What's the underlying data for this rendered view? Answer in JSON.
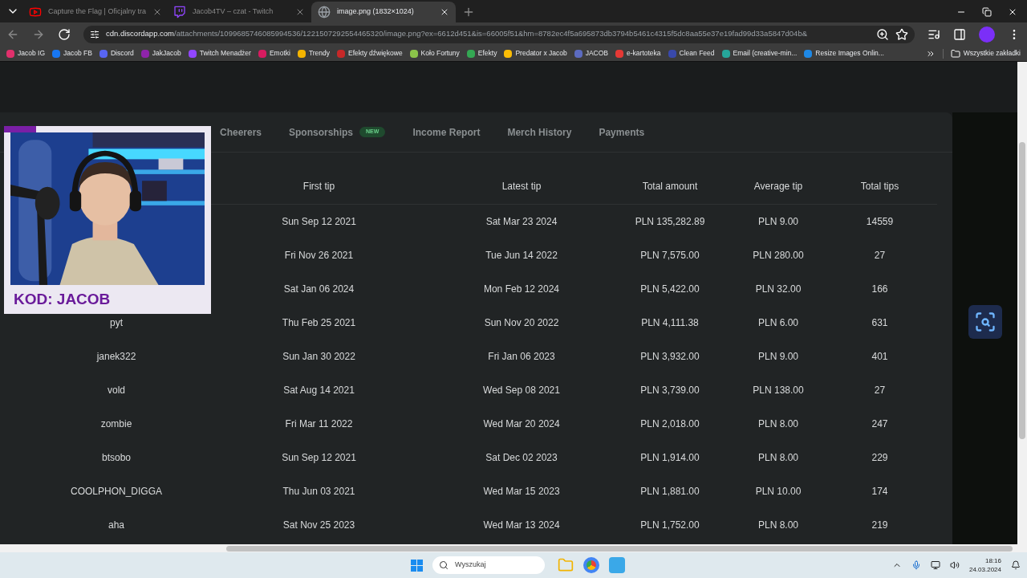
{
  "browser": {
    "tabs": [
      {
        "title": "Capture the Flag | Oficjalny tra",
        "kind": "youtube",
        "selected": false
      },
      {
        "title": "Jacob4TV – czat - Twitch",
        "kind": "twitch",
        "selected": false
      },
      {
        "title": "image.png (1832×1024)",
        "kind": "globe",
        "selected": true
      }
    ],
    "address": {
      "host": "cdn.discordapp.com",
      "path": "/attachments/1099685746085994536/1221507292554465320/image.png?ex=6612d451&is=66005f51&hm=8782ec4f5a695873db3794b5461c4315f5dc8aa55e37e19fad99d33a5847d04b&"
    },
    "bookmarks": [
      {
        "label": "Jacob IG",
        "color": "#e1306c"
      },
      {
        "label": "Jacob FB",
        "color": "#1877f2"
      },
      {
        "label": "Discord",
        "color": "#5865f2"
      },
      {
        "label": "JakJacob",
        "color": "#8e24aa"
      },
      {
        "label": "Twitch Menadżer",
        "color": "#9146ff"
      },
      {
        "label": "Emotki",
        "color": "#d81b60"
      },
      {
        "label": "Trendy",
        "color": "#f4b400"
      },
      {
        "label": "Efekty dźwiękowe",
        "color": "#c62828"
      },
      {
        "label": "Koło Fortuny",
        "color": "#8bc34a"
      },
      {
        "label": "Efekty",
        "color": "#34a853"
      },
      {
        "label": "Predator x Jacob",
        "color": "#fbbc05"
      },
      {
        "label": "JACOB",
        "color": "#5c6bc0"
      },
      {
        "label": "e-kartoteka",
        "color": "#e53935"
      },
      {
        "label": "Clean Feed",
        "color": "#3949ab"
      },
      {
        "label": "Email (creative-min...",
        "color": "#26a69a"
      },
      {
        "label": "Resize Images Onlin...",
        "color": "#1e88e5"
      }
    ],
    "all_bookmarks": "Wszystkie zakładki"
  },
  "page": {
    "tabs": [
      {
        "label": "Cheerers"
      },
      {
        "label": "Sponsorships",
        "badge": "NEW"
      },
      {
        "label": "Income Report"
      },
      {
        "label": "Merch History"
      },
      {
        "label": "Payments"
      }
    ],
    "table": {
      "columns": [
        "First tip",
        "Latest tip",
        "Total amount",
        "Average tip",
        "Total tips"
      ],
      "rows": [
        {
          "first": "Sun Sep 12 2021",
          "latest": "Sat Mar 23 2024",
          "total": "PLN 135,282.89",
          "average": "PLN 9.00",
          "count": "14559"
        },
        {
          "first": "Fri Nov 26 2021",
          "latest": "Tue Jun 14 2022",
          "total": "PLN 7,575.00",
          "average": "PLN 280.00",
          "count": "27"
        },
        {
          "first": "Sat Jan 06 2024",
          "latest": "Mon Feb 12 2024",
          "total": "PLN 5,422.00",
          "average": "PLN 32.00",
          "count": "166"
        },
        {
          "name": "pyt",
          "first": "Thu Feb 25 2021",
          "latest": "Sun Nov 20 2022",
          "total": "PLN 4,111.38",
          "average": "PLN 6.00",
          "count": "631"
        },
        {
          "name": "janek322",
          "first": "Sun Jan 30 2022",
          "latest": "Fri Jan 06 2023",
          "total": "PLN 3,932.00",
          "average": "PLN 9.00",
          "count": "401"
        },
        {
          "name": "vold",
          "first": "Sat Aug 14 2021",
          "latest": "Wed Sep 08 2021",
          "total": "PLN 3,739.00",
          "average": "PLN 138.00",
          "count": "27"
        },
        {
          "name": "zombie",
          "first": "Fri Mar 11 2022",
          "latest": "Wed Mar 20 2024",
          "total": "PLN 2,018.00",
          "average": "PLN 8.00",
          "count": "247"
        },
        {
          "name": "btsobo",
          "first": "Sun Sep 12 2021",
          "latest": "Sat Dec 02 2023",
          "total": "PLN 1,914.00",
          "average": "PLN 8.00",
          "count": "229"
        },
        {
          "name": "COOLPHON_DIGGA",
          "first": "Thu Jun 03 2021",
          "latest": "Wed Mar 15 2023",
          "total": "PLN 1,881.00",
          "average": "PLN 10.00",
          "count": "174"
        },
        {
          "name": "aha",
          "first": "Sat Nov 25 2023",
          "latest": "Wed Mar 13 2024",
          "total": "PLN 1,752.00",
          "average": "PLN 8.00",
          "count": "219"
        }
      ]
    }
  },
  "overlay": {
    "kind": "picture",
    "label": "KOD: JACOB"
  },
  "taskbar": {
    "search": {
      "placeholder": "Wyszukaj"
    },
    "time": "18:16",
    "date": "24.03.2024"
  }
}
